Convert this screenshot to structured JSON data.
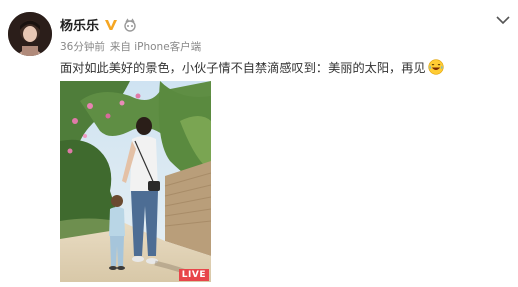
{
  "post": {
    "author": {
      "name": "杨乐乐",
      "verified_icon": "verified-v-icon",
      "level_icon": "member-level-icon"
    },
    "meta": {
      "time": "36分钟前",
      "source": "来自 iPhone客户端"
    },
    "content": {
      "text": "面对如此美好的景色，小伙子情不自禁滴感叹到：美丽的太阳，再见",
      "emoji": "laugh-cry-emoji-icon"
    },
    "media": {
      "badge": "LIVE"
    },
    "menu_icon": "chevron-down-icon"
  },
  "colors": {
    "verified": "#f5a623",
    "live_badge": "#e8454a",
    "meta_text": "#888888"
  }
}
